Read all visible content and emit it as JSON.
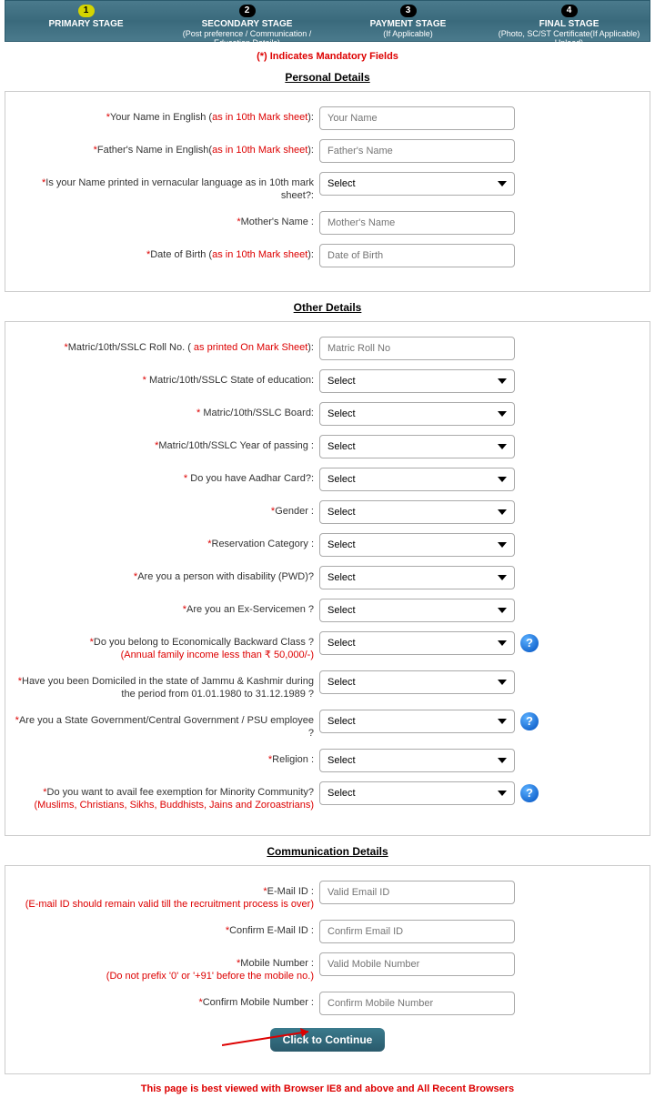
{
  "stages": [
    {
      "num": "1",
      "title": "PRIMARY STAGE",
      "sub": "",
      "active": true
    },
    {
      "num": "2",
      "title": "SECONDARY STAGE",
      "sub": "(Post preference / Communication / Education Details)",
      "active": false
    },
    {
      "num": "3",
      "title": "PAYMENT STAGE",
      "sub": "(If Applicable)",
      "active": false
    },
    {
      "num": "4",
      "title": "FINAL STAGE",
      "sub": "(Photo, SC/ST Certificate(If Applicable) Upload)",
      "active": false
    }
  ],
  "mandatory_msg": "(*) Indicates Mandatory Fields",
  "sections": {
    "personal": "Personal Details",
    "other": "Other Details",
    "comm": "Communication Details"
  },
  "personal": {
    "name_label": "Your Name in English (",
    "name_hint": "as in 10th Mark sheet",
    "name_label_end": "):",
    "name_ph": "Your Name",
    "father_label": "Father's Name in English(",
    "father_hint": "as in 10th Mark sheet",
    "father_label_end": "):",
    "father_ph": "Father's Name",
    "vernacular_label": "Is your Name printed in vernacular language as in 10th mark sheet?:",
    "mother_label": "Mother's Name :",
    "mother_ph": "Mother's Name",
    "dob_label": "Date of Birth (",
    "dob_hint": "as in 10th Mark sheet",
    "dob_label_end": "):",
    "dob_ph": "Date of Birth"
  },
  "other": {
    "roll_label": "Matric/10th/SSLC Roll No. ( ",
    "roll_hint": "as printed On Mark Sheet",
    "roll_label_end": "):",
    "roll_ph": "Matric Roll No",
    "state_label": " Matric/10th/SSLC State of education:",
    "board_label": " Matric/10th/SSLC Board:",
    "year_label": "Matric/10th/SSLC Year of passing :",
    "aadhar_label": " Do you have Aadhar Card?:",
    "gender_label": "Gender :",
    "category_label": "Reservation Category :",
    "pwd_label": "Are you a person with disability (PWD)?",
    "exservice_label": "Are you an Ex-Servicemen ?",
    "ebc_label": "Do you belong to Economically Backward Class ?",
    "ebc_hint": "(Annual family income less than ₹ 50,000/-)",
    "jk_label": "Have you been Domiciled in the state of Jammu & Kashmir during the period from 01.01.1980 to 31.12.1989 ?",
    "govt_label": "Are you a State Government/Central Government / PSU employee ?",
    "religion_label": "Religion :",
    "minority_label": "Do you want to avail fee exemption for Minority Community?",
    "minority_hint": "(Muslims, Christians, Sikhs, Buddhists, Jains and Zoroastrians)"
  },
  "comm": {
    "email_label": "E-Mail ID :",
    "email_hint": "(E-mail ID should remain valid till the recruitment process is over)",
    "email_ph": "Valid Email ID",
    "cemail_label": "Confirm E-Mail ID :",
    "cemail_ph": "Confirm Email ID",
    "mobile_label": "Mobile Number :",
    "mobile_hint": "(Do not prefix '0' or '+91' before the mobile no.)",
    "mobile_ph": "Valid Mobile Number",
    "cmobile_label": "Confirm Mobile Number :",
    "cmobile_ph": "Confirm Mobile Number"
  },
  "select_default": "Select",
  "continue_btn": "Click to Continue",
  "footer": "This page is best viewed with Browser IE8 and above and All Recent Browsers"
}
